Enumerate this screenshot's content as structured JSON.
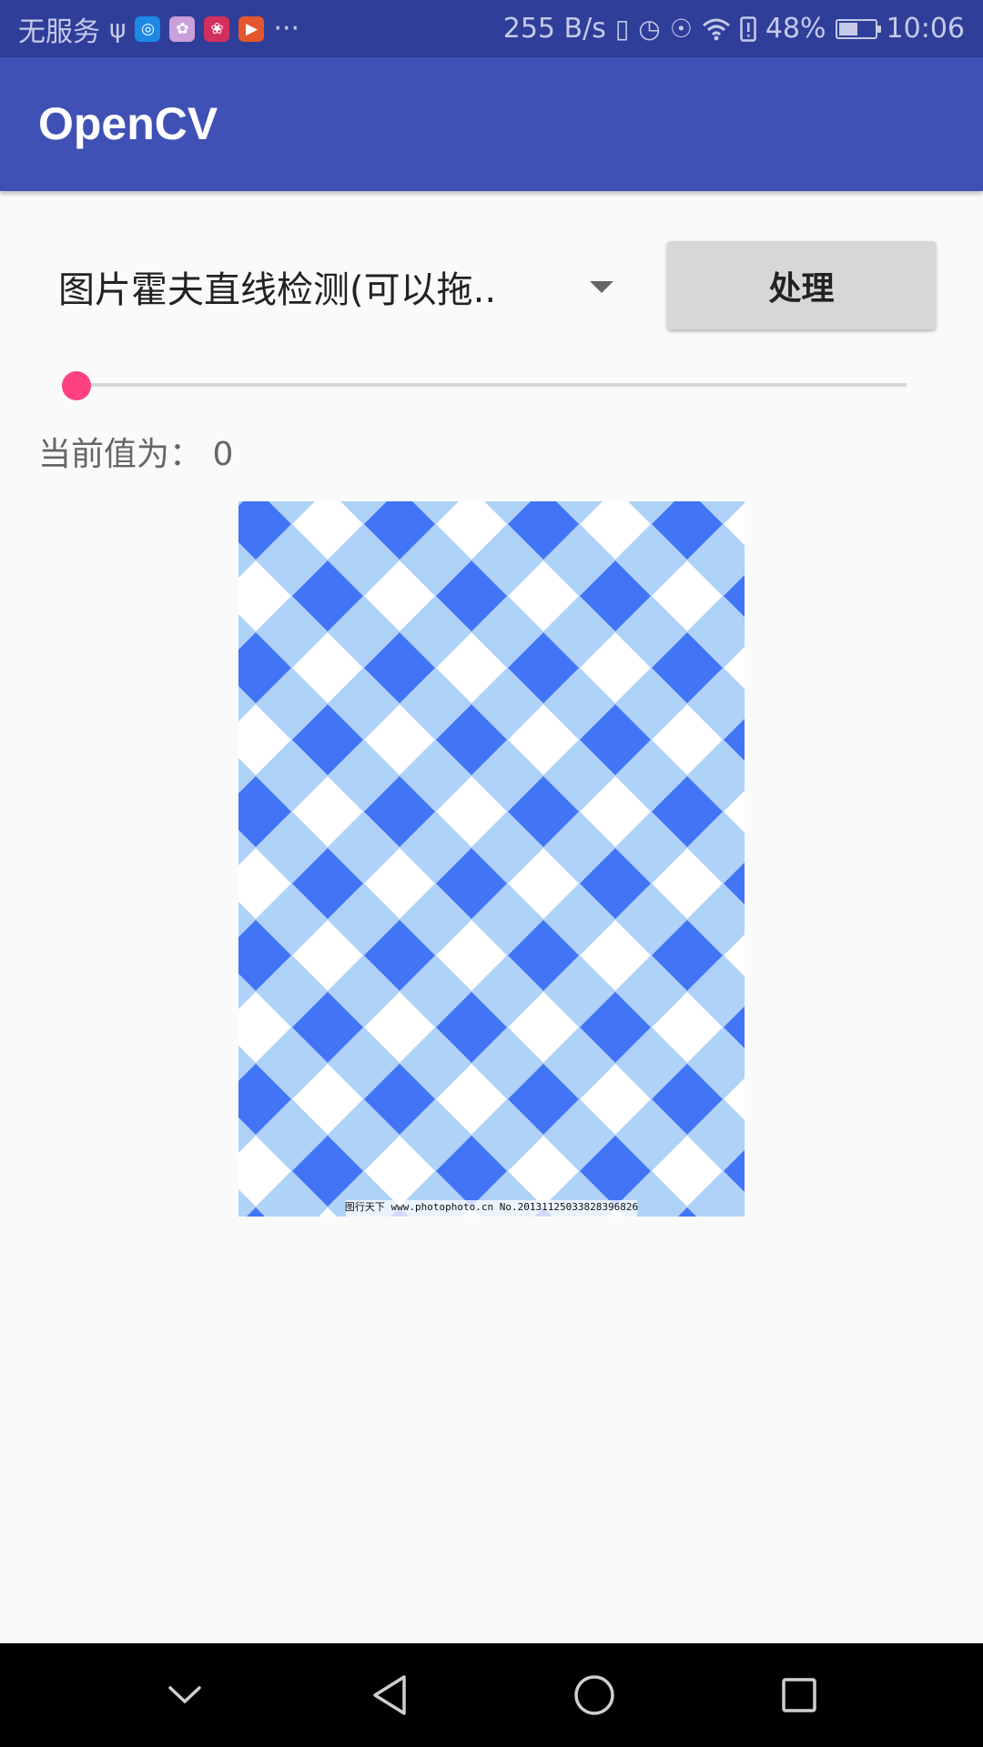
{
  "status_bar": {
    "carrier": "无服务",
    "usb_icon": "usb-icon",
    "notification_icons": [
      "compass-app-icon",
      "photos-app-icon",
      "huawei-app-icon",
      "video-app-icon"
    ],
    "more": "···",
    "network_speed": "255 B/s",
    "battery_percent": "48%",
    "time": "10:06"
  },
  "app_bar": {
    "title": "OpenCV"
  },
  "controls": {
    "spinner_selected": "图片霍夫直线检测(可以拖..",
    "process_label": "处理"
  },
  "slider": {
    "value": 0
  },
  "current_value_text": "当前值为： 0",
  "image": {
    "watermark": "图行天下 www.photophoto.cn  No.20131125033828396826",
    "colors": {
      "light": "#aed2f8",
      "dark": "#4374f6",
      "white": "#ffffff"
    }
  },
  "nav_bar": {
    "icons": [
      "chevron-down-icon",
      "back-icon",
      "home-icon",
      "recents-icon"
    ]
  },
  "colors": {
    "status_bar": "#2f3e98",
    "app_bar": "#3f51b5",
    "accent": "#ff4081",
    "button": "#d6d7d7"
  }
}
